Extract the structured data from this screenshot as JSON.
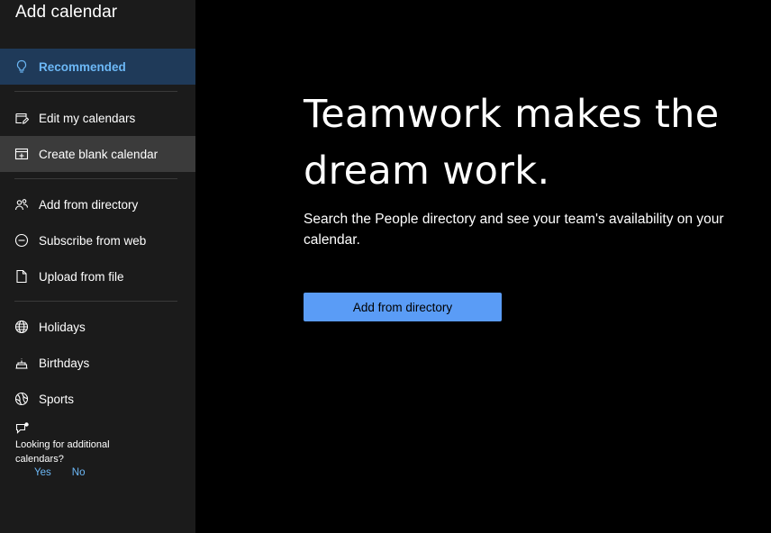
{
  "sidebar": {
    "title": "Add calendar",
    "items": [
      {
        "label": "Recommended",
        "icon": "lightbulb-icon"
      },
      {
        "label": "Edit my calendars",
        "icon": "edit-calendar-icon"
      },
      {
        "label": "Create blank calendar",
        "icon": "calendar-add-icon"
      },
      {
        "label": "Add from directory",
        "icon": "people-icon"
      },
      {
        "label": "Subscribe from web",
        "icon": "web-link-icon"
      },
      {
        "label": "Upload from file",
        "icon": "file-upload-icon"
      },
      {
        "label": "Holidays",
        "icon": "globe-icon"
      },
      {
        "label": "Birthdays",
        "icon": "cake-icon"
      },
      {
        "label": "Sports",
        "icon": "sports-ball-icon"
      }
    ],
    "feedback": {
      "icon": "feedback-icon",
      "question": "Looking for additional calendars?",
      "yes_label": "Yes",
      "no_label": "No"
    }
  },
  "main": {
    "title": "Teamwork makes the dream work.",
    "description": "Search the People directory and see your team's availability on your calendar.",
    "button_label": "Add from directory"
  },
  "colors": {
    "accent": "#6cb8f6",
    "button": "#5a9cf6",
    "selected_bg": "#1f3a59",
    "sidebar_bg": "#1b1b1b"
  }
}
